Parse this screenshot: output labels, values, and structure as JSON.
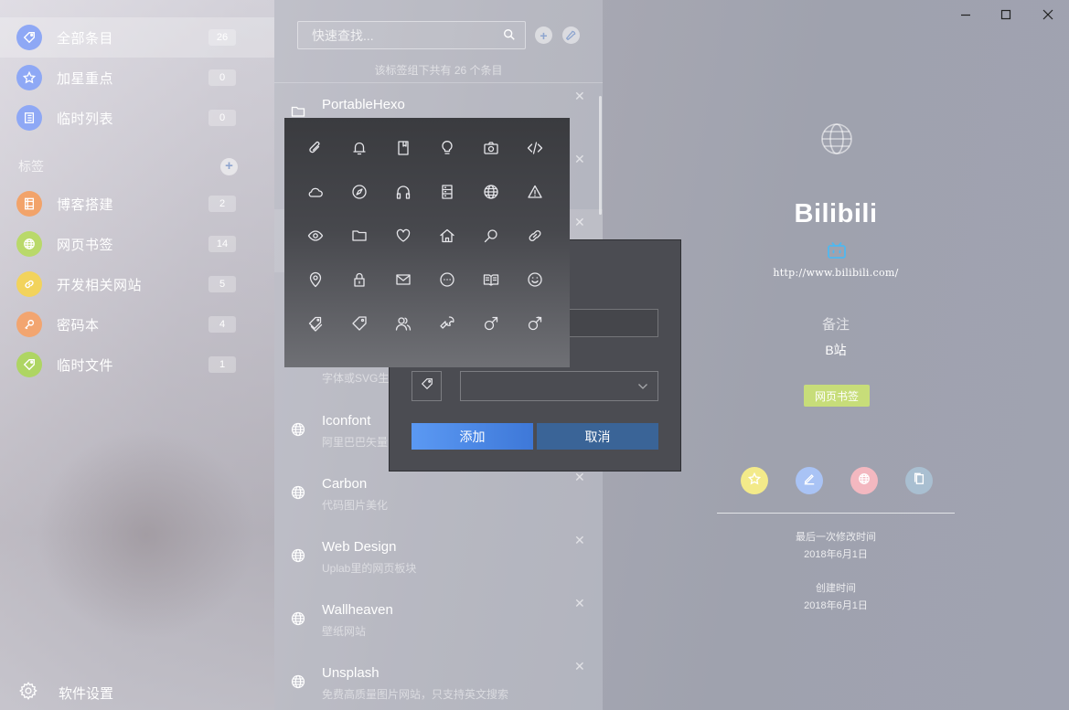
{
  "sidebar": {
    "items": [
      {
        "label": "全部条目",
        "count": "26",
        "icon": "tag-icon",
        "color": "#8ea8f5"
      },
      {
        "label": "加星重点",
        "count": "0",
        "icon": "star-icon",
        "color": "#8ea8f5"
      },
      {
        "label": "临时列表",
        "count": "0",
        "icon": "list-icon",
        "color": "#8ea8f5"
      }
    ],
    "tag_header": "标签",
    "tags": [
      {
        "label": "博客搭建",
        "count": "2",
        "icon": "film-icon",
        "color": "#f2a36a"
      },
      {
        "label": "网页书签",
        "count": "14",
        "icon": "globe-icon",
        "color": "#b9d96a"
      },
      {
        "label": "开发相关网站",
        "count": "5",
        "icon": "link-icon",
        "color": "#f2d35c"
      },
      {
        "label": "密码本",
        "count": "4",
        "icon": "key-icon",
        "color": "#f2a570"
      },
      {
        "label": "临时文件",
        "count": "1",
        "icon": "tag-icon",
        "color": "#aed563"
      }
    ],
    "settings_label": "软件设置"
  },
  "list": {
    "search_placeholder": "快速查找...",
    "summary": "该标签组下共有 26 个条目",
    "entries": [
      {
        "title": "PortableHexo",
        "subtitle": "",
        "icon": "folder-icon"
      },
      {
        "title": "",
        "subtitle": "字体或SVG生",
        "icon": ""
      },
      {
        "title": "Iconfont",
        "subtitle": "阿里巴巴矢量",
        "icon": "globe-icon"
      },
      {
        "title": "Carbon",
        "subtitle": "代码图片美化",
        "icon": "globe-icon"
      },
      {
        "title": "Web Design",
        "subtitle": "Uplab里的网页板块",
        "icon": "globe-icon"
      },
      {
        "title": "Wallheaven",
        "subtitle": "壁纸网站",
        "icon": "globe-icon"
      },
      {
        "title": "Unsplash",
        "subtitle": "免费高质量图片网站，只支持英文搜索",
        "icon": "globe-icon"
      }
    ]
  },
  "detail": {
    "title": "Bilibili",
    "url": "http://www.bilibili.com/",
    "note_label": "备注",
    "note_value": "B站",
    "tag": "网页书签",
    "tag_color": "#c7dd79",
    "actions": [
      {
        "icon": "star-icon",
        "color": "#f3ea8a"
      },
      {
        "icon": "edit-icon",
        "color": "#a9c3f5"
      },
      {
        "icon": "globe-icon",
        "color": "#f3b8c0"
      },
      {
        "icon": "copy-icon",
        "color": "#a9bfd1"
      }
    ],
    "modified_label": "最后一次修改时间",
    "modified_date": "2018年6月1日",
    "created_label": "创建时间",
    "created_date": "2018年6月1日"
  },
  "icon_picker": {
    "icons": [
      "paperclip-icon",
      "bell-icon",
      "bookmark-icon",
      "lightbulb-icon",
      "camera-icon",
      "code-icon",
      "cloud-icon",
      "compass-icon",
      "headphones-icon",
      "server-icon",
      "globe-icon",
      "warning-icon",
      "eye-icon",
      "folder-icon",
      "heart-icon",
      "home-icon",
      "search-icon",
      "link-icon",
      "location-pin-icon",
      "lock-icon",
      "mail-icon",
      "chat-icon",
      "book-open-icon",
      "smile-icon",
      "tags-icon",
      "tag-icon",
      "users-icon",
      "wrench-icon",
      "male-icon",
      "male-icon"
    ]
  },
  "dialog": {
    "add_label": "添加",
    "cancel_label": "取消"
  }
}
